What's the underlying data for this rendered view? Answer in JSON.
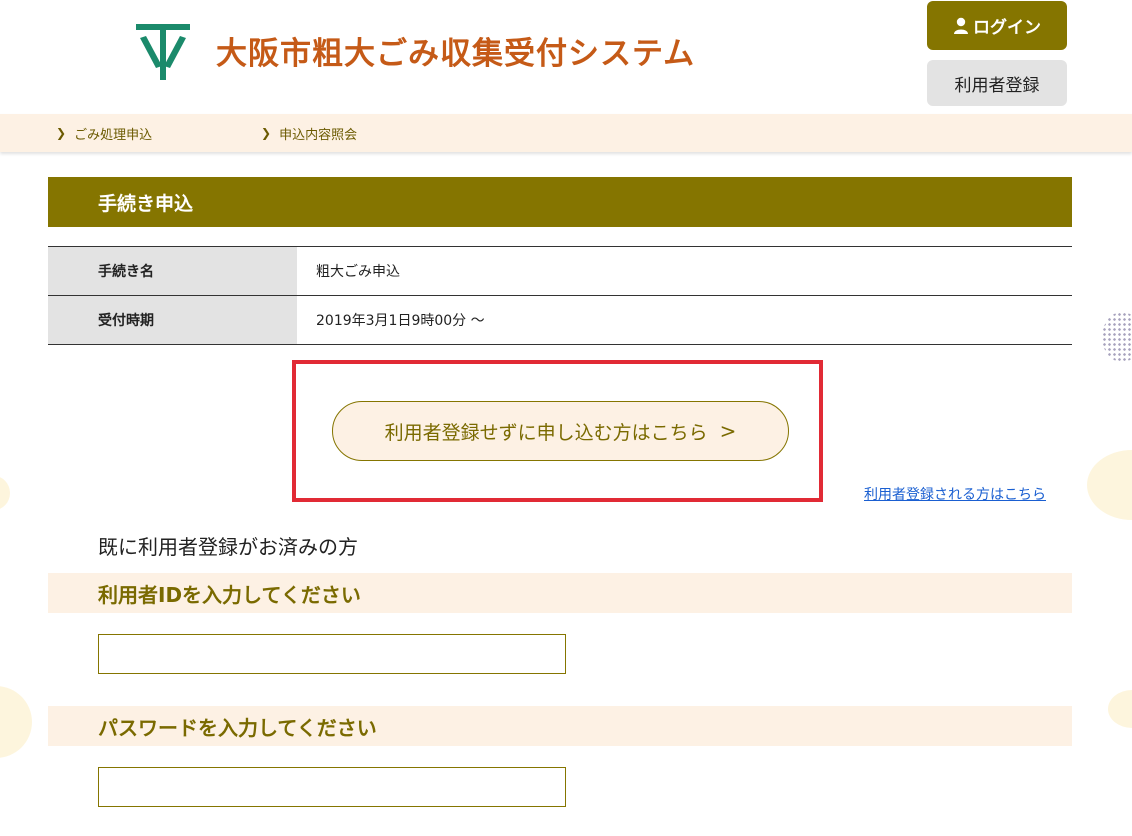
{
  "header": {
    "site_title": "大阪市粗大ごみ収集受付システム",
    "login_label": "ログイン",
    "register_label": "利用者登録"
  },
  "nav": {
    "items": [
      {
        "label": "ごみ処理申込"
      },
      {
        "label": "申込内容照会"
      }
    ]
  },
  "section": {
    "title": "手続き申込"
  },
  "info": {
    "rows": [
      {
        "head": "手続き名",
        "value": "粗大ごみ申込"
      },
      {
        "head": "受付時期",
        "value": "2019年3月1日9時00分 〜"
      }
    ]
  },
  "guest": {
    "button_label": "利用者登録せずに申し込む方はこちら",
    "chevron": ">"
  },
  "register_link": "利用者登録される方はこちら",
  "login_section": {
    "already_text": "既に利用者登録がお済みの方",
    "id_label": "利用者IDを入力してください",
    "id_value": "",
    "password_label": "パスワードを入力してください",
    "password_value": ""
  },
  "colors": {
    "brand_olive": "#857500",
    "title_orange": "#c55a17",
    "highlight_red": "#e12a35",
    "logo_green": "#1b8a6b",
    "link_blue": "#1a5fd1"
  }
}
